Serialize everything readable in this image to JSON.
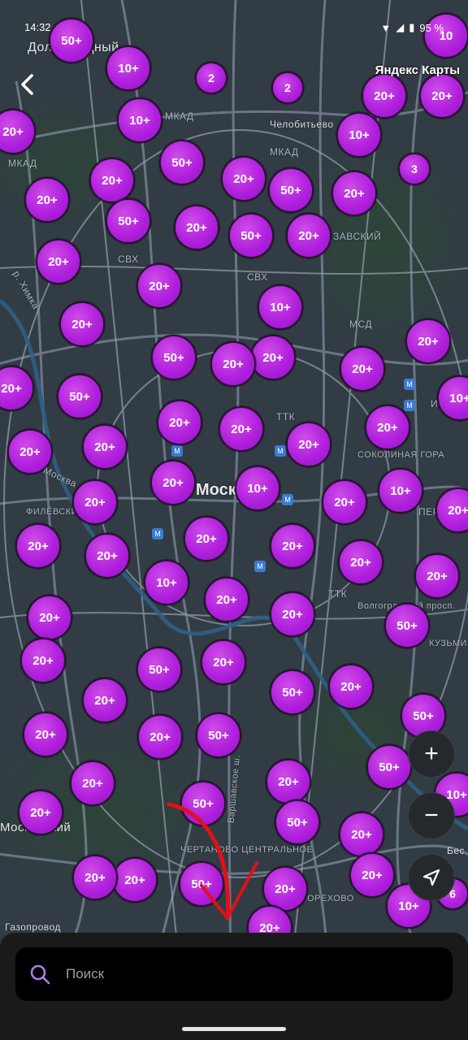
{
  "status_bar": {
    "time": "14:32",
    "battery": "95 %"
  },
  "header": {
    "back_icon": "chevron-left-icon",
    "brand": "Яндекс Карты"
  },
  "map_labels": [
    "Долгопрудный",
    "Челобитьево",
    "МКАД",
    "МКАД",
    "МКАД",
    "СВХ",
    "СВХ",
    "МСД",
    "ТТК",
    "р. Химка",
    "ЗАВСКИЙ",
    "Москва",
    "ФИЛЁВСКИЙ ПАРК",
    "СОКОЛИНАЯ ГОРА",
    "ИЗМ",
    "ПЕР",
    "ТТК",
    "Волгоградский просп.",
    "КУЗЬМИНКИ",
    "Варшавское ш.",
    "ЧЕРТАНОВО ЦЕНТРАЛЬНОЕ",
    "ОРЕХОВО",
    "Газопровод",
    "Московский",
    "Бес"
  ],
  "city_label": "Москва",
  "clusters": [
    "50+",
    "10+",
    "2",
    "2",
    "10",
    "20+",
    "20+",
    "10+",
    "20+",
    "10+",
    "3",
    "20+",
    "50+",
    "20+",
    "20+",
    "50+",
    "20+",
    "20+",
    "50+",
    "20+",
    "50+",
    "20+",
    "20+",
    "20+",
    "10+",
    "20+",
    "20+",
    "50+",
    "20+",
    "20+",
    "20+",
    "50+",
    "20+",
    "20+",
    "20+",
    "20+",
    "20+",
    "10+",
    "20+",
    "10+",
    "20+",
    "20+",
    "20+",
    "20+",
    "10+",
    "20+",
    "20+",
    "20+",
    "10+",
    "20+",
    "20+",
    "20+",
    "20+",
    "50+",
    "20+",
    "20+",
    "50+",
    "20+",
    "20+",
    "20+",
    "50+",
    "20+",
    "50+",
    "20+",
    "50+",
    "20+",
    "20+",
    "50+",
    "50+",
    "20+",
    "20+",
    "50+",
    "10+",
    "20+",
    "50+",
    "20+",
    "20+",
    "20+",
    "10+",
    "6",
    "20+",
    "20+"
  ],
  "controls": {
    "zoom_in": "+",
    "zoom_out": "−",
    "locate_icon": "navigation-arrow-icon"
  },
  "search": {
    "placeholder": "Поиск",
    "icon": "search-icon"
  },
  "colors": {
    "cluster": "#b020dd",
    "map_bg": "#323c44",
    "sheet_bg": "#1a1a1a",
    "arrow": "#e0101a"
  }
}
